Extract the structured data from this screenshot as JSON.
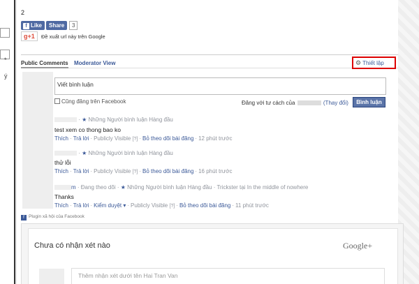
{
  "left_panel": {
    "marks": [
      "*",
      "ý"
    ]
  },
  "top": {
    "count": "2"
  },
  "social": {
    "like_label": "Like",
    "share_label": "Share",
    "share_count": "3",
    "gplus_label": "g+1",
    "gplus_text": "Đề xuất url này trên Google"
  },
  "tabs": {
    "public": "Public Comments",
    "moderator": "Moderator View",
    "settings": "Thiết lập"
  },
  "composer": {
    "placeholder": "Viết bình luận",
    "also_post": "Cũng đăng trên Facebook",
    "post_as_prefix": "Đăng với tư cách của",
    "post_as_change": "(Thay đổi)",
    "post_button": "Bình luận"
  },
  "comments": [
    {
      "name_suffix": "",
      "following": "",
      "badge": "Những Người bình luận Hàng đầu",
      "location": "",
      "text": "test xem co thong bao ko",
      "actions": {
        "like": "Thích",
        "reply": "Trả lời",
        "moderate": "",
        "visibility": "Publicly Visible",
        "visibility_hint": "[?]",
        "unfollow": "Bỏ theo dõi bài đăng",
        "time": "12 phút trước"
      }
    },
    {
      "name_suffix": "",
      "following": "",
      "badge": "Những Người bình luận Hàng đầu",
      "location": "",
      "text": "thử lỗi",
      "actions": {
        "like": "Thích",
        "reply": "Trả lời",
        "moderate": "",
        "visibility": "Publicly Visible",
        "visibility_hint": "[?]",
        "unfollow": "Bỏ theo dõi bài đăng",
        "time": "16 phút trước"
      }
    },
    {
      "name_suffix": "m",
      "following": "Đang theo dõi",
      "badge": "Những Người bình luận Hàng đầu",
      "location": "Trickster tại In the middle of nowhere",
      "text": "Thanks",
      "actions": {
        "like": "Thích",
        "reply": "Trả lời",
        "moderate": "Kiểm duyệt",
        "visibility": "Publicly Visible",
        "visibility_hint": "[?]",
        "unfollow": "Bỏ theo dõi bài đăng",
        "time": "11 phút trước"
      }
    }
  ],
  "plugin": {
    "label": "Plugin xã hội của Facebook"
  },
  "google_plus": {
    "empty_title": "Chưa có nhận xét nào",
    "logo": "Google+",
    "input_placeholder": "Thêm nhận xét dưới tên Hai Tran Van"
  }
}
